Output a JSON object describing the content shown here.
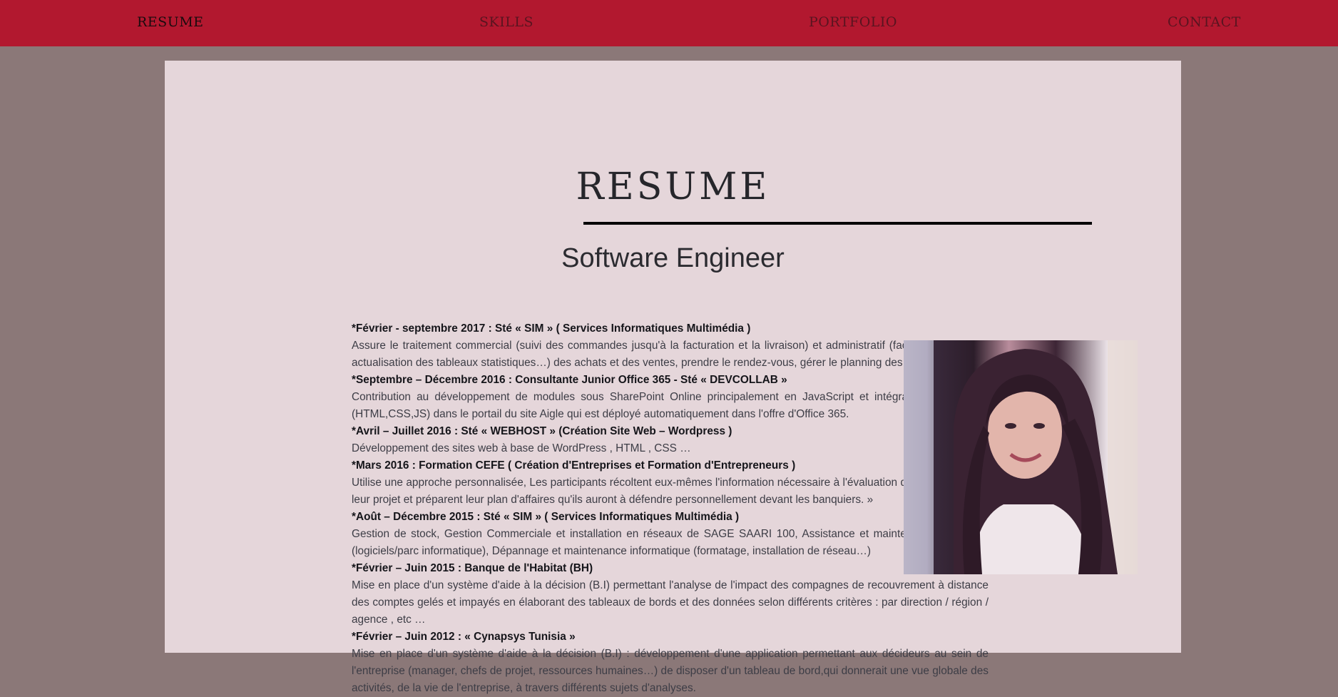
{
  "nav": {
    "items": [
      {
        "label": "RESUME",
        "active": true
      },
      {
        "label": "SKILLS",
        "active": false
      },
      {
        "label": "PORTFOLIO",
        "active": false
      },
      {
        "label": "CONTACT",
        "active": false
      }
    ]
  },
  "resume": {
    "title": "RESUME",
    "subtitle": "Software Engineer",
    "entries": [
      {
        "title": "*Février - septembre 2017 : Sté « SIM » ( Services Informatiques Multimédia )",
        "description": "Assure le traitement commercial (suivi des commandes jusqu'à la facturation et la livraison) et administratif (factures, devis, BL, actualisation des tableaux statistiques…) des achats et des ventes, prendre le rendez-vous, gérer le planning des commerciaux …"
      },
      {
        "title": "*Septembre – Décembre 2016 : Consultante Junior Office 365 - Sté « DEVCOLLAB »",
        "description": "Contribution au développement de modules sous SharePoint Online principalement en JavaScript et intégration du contenu (HTML,CSS,JS) dans le portail du site Aigle qui est déployé automatiquement dans l'offre d'Office 365."
      },
      {
        "title": "*Avril – Juillet 2016 : Sté « WEBHOST » (Création Site Web – Wordpress )",
        "description": "Développement des sites web à base de WordPress , HTML , CSS …"
      },
      {
        "title": "*Mars 2016 : Formation CEFE ( Création d'Entreprises et Formation d'Entrepreneurs )",
        "description": "Utilise une approche personnalisée, Les participants récoltent eux-mêmes l'information nécessaire à l'évaluation de la faisabilité de leur projet et préparent leur plan d'affaires qu'ils auront à défendre personnellement devant les banquiers. »"
      },
      {
        "title": "*Août – Décembre 2015 : Sté « SIM » ( Services Informatiques Multimédia )",
        "description": "Gestion de stock, Gestion Commerciale et installation en réseaux de SAGE SAARI 100, Assistance et maintenance technique (logiciels/parc informatique), Dépannage et maintenance informatique (formatage, installation de réseau…)"
      },
      {
        "title": "*Février – Juin 2015 : Banque de l'Habitat (BH)",
        "description": "Mise en place d'un système d'aide à la décision (B.I) permettant l'analyse de l'impact des compagnes de recouvrement à distance des comptes gelés et impayés en élaborant des tableaux de bords et des données selon différents critères : par direction / région / agence , etc …"
      },
      {
        "title": "*Février – Juin 2012 : « Cynapsys Tunisia »",
        "description": "Mise en place d'un système d'aide à la décision (B.I) : développement d'une application permettant aux décideurs au sein de l'entreprise (manager, chefs de projet, ressources humaines…) de disposer d'un tableau de bord,qui donnerait une vue globale des activités, de la vie de l'entreprise, à travers différents sujets d'analyses."
      }
    ]
  },
  "colors": {
    "navbar": "#b2182f",
    "page_background": "#8b7878",
    "card_background": "#e5d6da"
  }
}
